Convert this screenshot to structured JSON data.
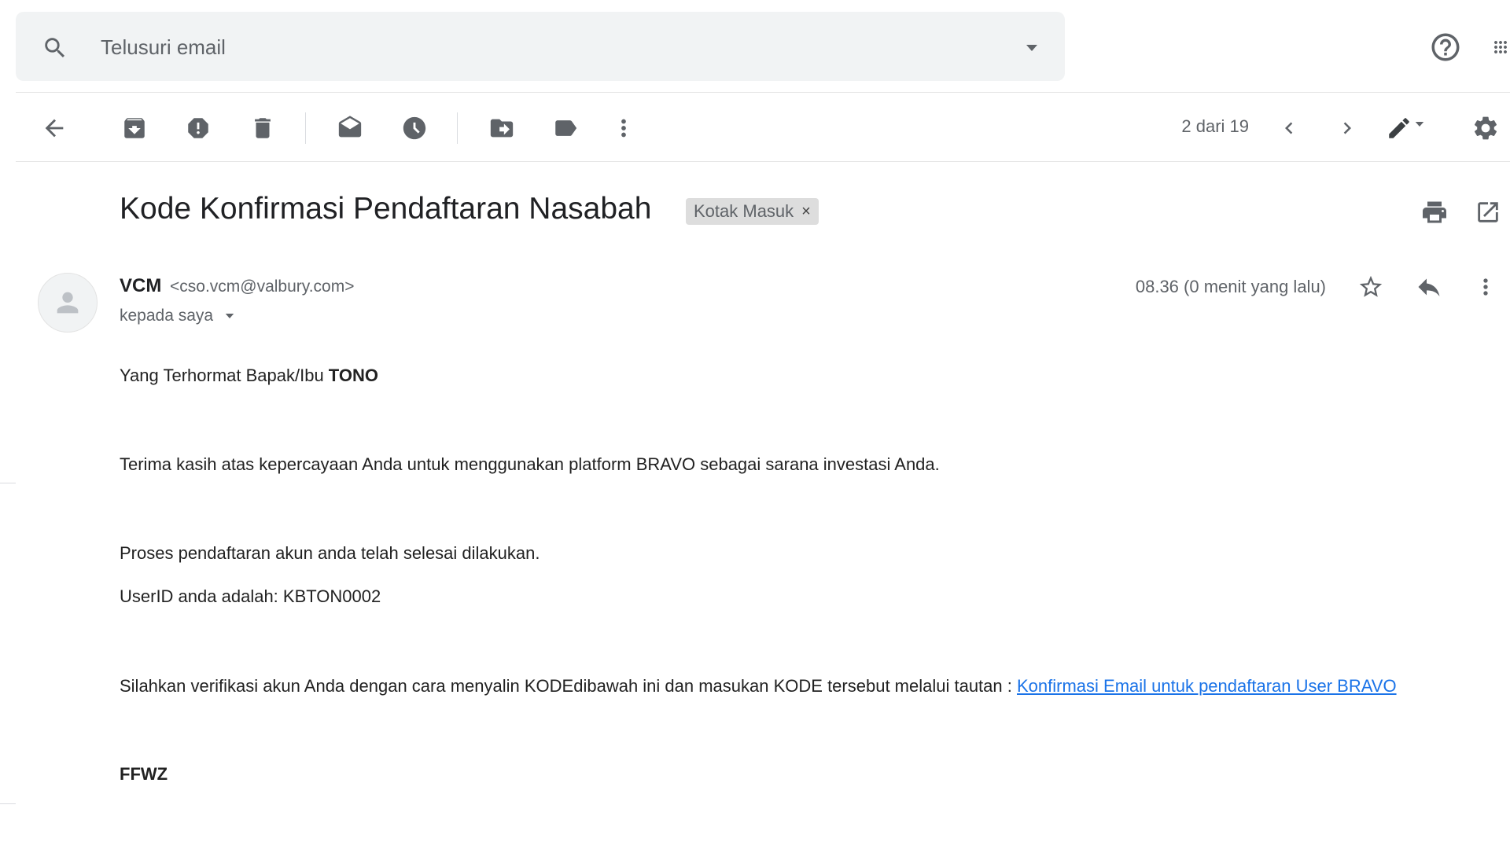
{
  "search": {
    "placeholder": "Telusuri email"
  },
  "toolbar": {
    "back_icon": "arrow-left-icon",
    "archive_icon": "archive-icon",
    "spam_icon": "report-spam-icon",
    "delete_icon": "trash-icon",
    "mark_unread_icon": "mark-unread-icon",
    "snooze_icon": "clock-icon",
    "move_icon": "move-to-icon",
    "label_icon": "label-icon",
    "more_icon": "more-vertical-icon",
    "counter": "2 dari 19",
    "prev_icon": "chevron-left-icon",
    "next_icon": "chevron-right-icon",
    "input_tools_icon": "pencil-icon",
    "settings_icon": "gear-icon"
  },
  "email": {
    "subject": "Kode Konfirmasi Pendaftaran Nasabah",
    "label": "Kotak Masuk",
    "label_remove": "×",
    "sender_name": "VCM",
    "sender_email": "<cso.vcm@valbury.com>",
    "recipient": "kepada saya",
    "time": "08.36 (0 menit yang lalu)",
    "body": {
      "greeting_prefix": "Yang Terhormat Bapak/Ibu ",
      "greeting_name": "TONO",
      "p1": "Terima kasih atas kepercayaan Anda untuk menggunakan platform BRAVO sebagai sarana investasi Anda.",
      "p2": "Proses pendaftaran akun anda telah selesai dilakukan.",
      "p3": "UserID anda adalah: KBTON0002",
      "p4_prefix": "Silahkan verifikasi akun Anda dengan cara menyalin KODEdibawah ini dan masukan KODE tersebut melalui tautan : ",
      "p4_link": "Konfirmasi Email untuk pendaftaran User BRAVO",
      "code": "FFWZ"
    }
  },
  "colors": {
    "accent_link": "#1a73e8",
    "icon_gray": "#5f6368",
    "search_bg": "#f1f3f4",
    "chip_bg": "#dddddd"
  }
}
